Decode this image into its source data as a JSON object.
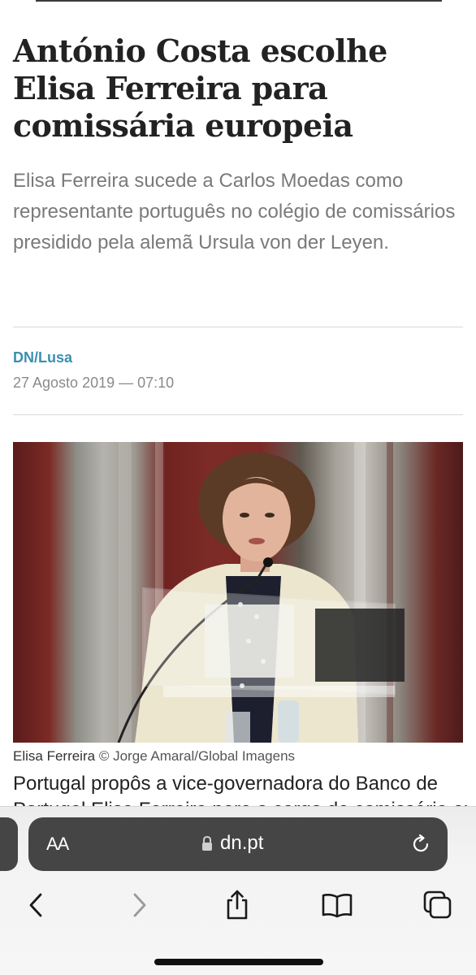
{
  "article": {
    "headline": "António Costa escolhe Elisa Ferreira para comissária europeia",
    "lead": "Elisa Ferreira sucede a Carlos Moedas como representante português no colégio de comissários presidido pela alemã Ursula von der Leyen.",
    "author": "DN/Lusa",
    "date": "27 Agosto 2019 — 07:10",
    "caption_name": "Elisa Ferreira",
    "caption_credit": "© Jorge Amaral/Global Imagens",
    "body_first_line": "Portugal propôs a vice-governadora do Banco de",
    "body_second_line": "Portugal Elisa Ferreira para o cargo de comissária europeia"
  },
  "browser": {
    "text_size_button": "AA",
    "url": "dn.pt",
    "icons": {
      "lock": "lock-icon",
      "reload": "reload-icon",
      "back": "chevron-left-icon",
      "forward": "chevron-right-icon",
      "share": "share-icon",
      "bookmarks": "book-icon",
      "tabs": "tabs-icon"
    }
  },
  "colors": {
    "author_link": "#3c8fb0",
    "headline": "#222222",
    "lead": "#7a7a7a",
    "address_bar": "#454545",
    "toolbar_icon": "#1a1a1a",
    "forward_disabled": "#9a9a9a"
  }
}
